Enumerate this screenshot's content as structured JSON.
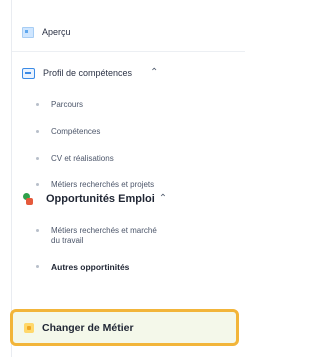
{
  "sidebar": {
    "apercu": {
      "label": "Aperçu",
      "icon": "dashboard-icon"
    },
    "profil": {
      "label": "Profil de compétences",
      "icon": "profile-card-icon",
      "expanded": true,
      "items": [
        {
          "label": "Parcours"
        },
        {
          "label": "Compétences"
        },
        {
          "label": "CV et réalisations"
        },
        {
          "label": "Métiers recherchés et projets"
        }
      ]
    },
    "opportunites": {
      "label": "Opportunités Emploi",
      "icon": "puzzle-icon",
      "expanded": true,
      "items": [
        {
          "label_line1": "Métiers recherchés et marché",
          "label_line2": "du travail"
        },
        {
          "label": "Autres opportinités"
        }
      ]
    },
    "changer": {
      "label": "Changer de Métier",
      "icon": "swap-icon"
    }
  },
  "colors": {
    "highlight_border": "#f2b53a",
    "highlight_bg": "#f4f8ea",
    "accent_blue": "#3b8be6"
  }
}
